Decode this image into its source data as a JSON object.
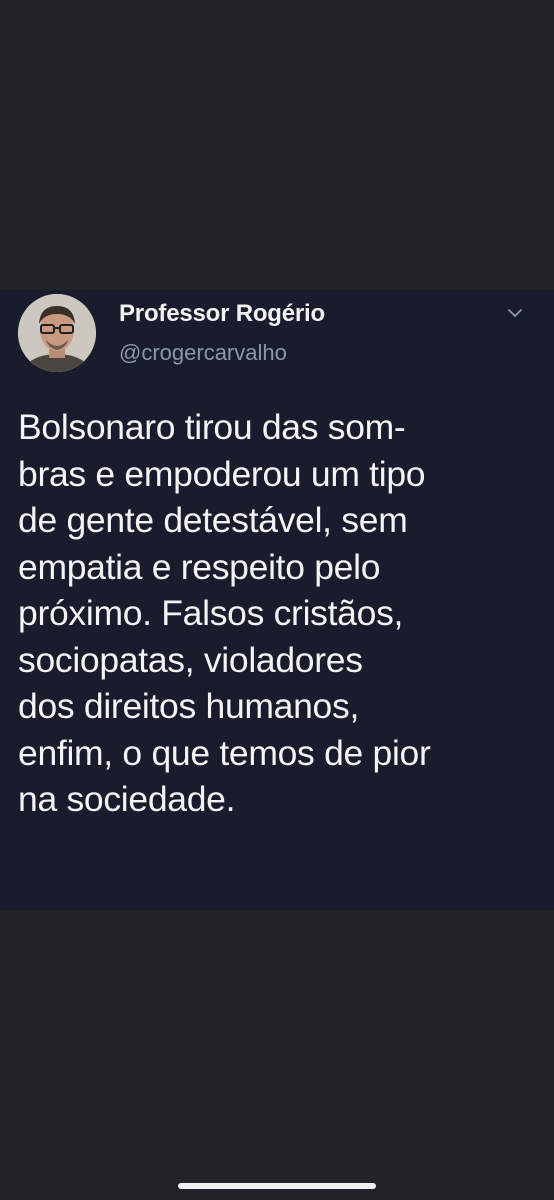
{
  "tweet": {
    "author": {
      "display_name": "Professor Rogério",
      "handle": "@crogercarvalho"
    },
    "menu_icon": "chevron-down-icon",
    "text_lines": [
      "Bolsonaro tirou das som-",
      "bras e empoderou um tipo",
      "de gente detestável, sem",
      "empatia e respeito pelo",
      "próximo. Falsos cristãos,",
      "sociopatas, violadores",
      "dos direitos humanos,",
      "enfim, o que temos de pior",
      "na sociedade."
    ]
  },
  "colors": {
    "page_background": "#222327",
    "card_background": "#181c2c",
    "text_primary": "#f4f4f4",
    "text_secondary": "#8b98a5"
  }
}
